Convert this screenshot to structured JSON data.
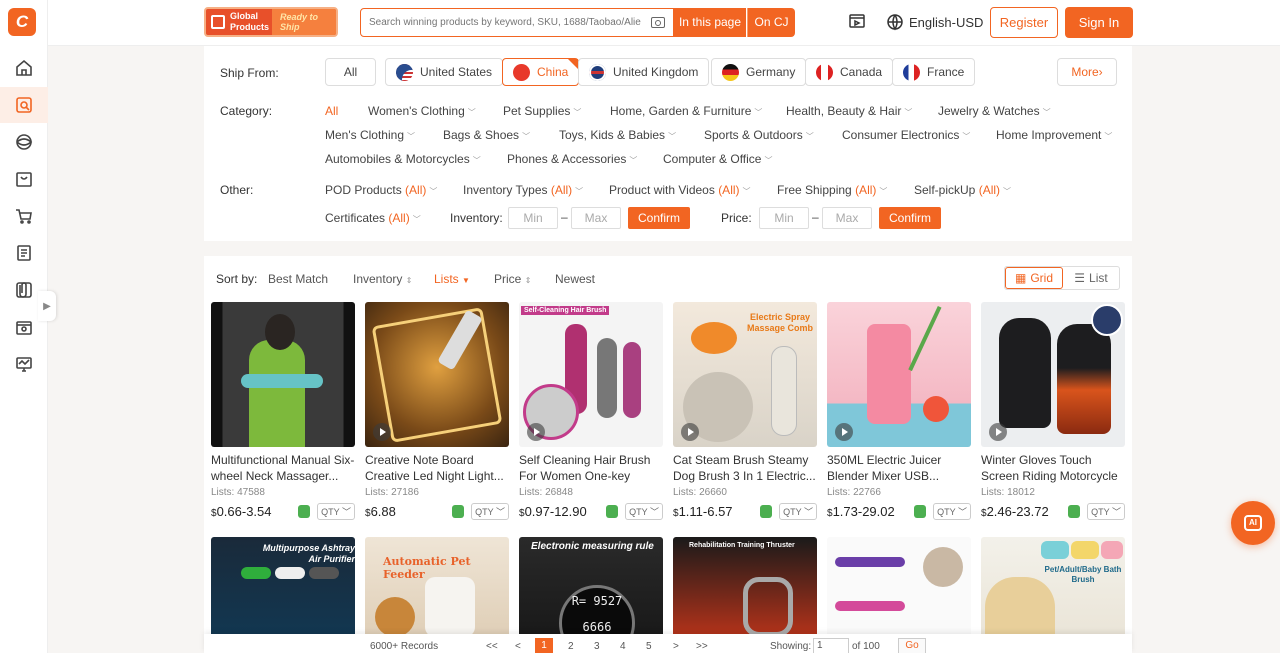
{
  "header": {
    "logo_text": "C",
    "banner_left": "Global Products",
    "banner_right": "Ready to Ship",
    "search_placeholder": "Search winning products by keyword, SKU, 1688/Taobao/Alie...",
    "search_in_page": "In this page",
    "search_on_cj": "On CJ",
    "language": "English-USD",
    "register": "Register",
    "sign_in": "Sign In"
  },
  "sidebar": {
    "items": [
      "home-icon",
      "product-search-icon",
      "globe-icon",
      "inbox-icon",
      "cart-icon",
      "orders-icon",
      "clip-icon",
      "store-icon",
      "monitor-icon"
    ],
    "active_index": 1
  },
  "filters": {
    "ship_from_label": "Ship From:",
    "countries": [
      {
        "label": "All",
        "flag": ""
      },
      {
        "label": "United States",
        "flag": "us"
      },
      {
        "label": "China",
        "flag": "cn",
        "selected": true
      },
      {
        "label": "United Kingdom",
        "flag": "uk"
      },
      {
        "label": "Germany",
        "flag": "de"
      },
      {
        "label": "Canada",
        "flag": "ca"
      },
      {
        "label": "France",
        "flag": "fr"
      }
    ],
    "more": "More",
    "category_label": "Category:",
    "categories": [
      "All",
      "Women's Clothing",
      "Pet Supplies",
      "Home, Garden & Furniture",
      "Health, Beauty & Hair",
      "Jewelry & Watches",
      "Men's Clothing",
      "Bags & Shoes",
      "Toys, Kids & Babies",
      "Sports & Outdoors",
      "Consumer Electronics",
      "Home Improvement",
      "Automobiles & Motorcycles",
      "Phones & Accessories",
      "Computer & Office"
    ],
    "other_label": "Other:",
    "other_items": [
      "POD Products",
      "Inventory Types",
      "Product with Videos",
      "Free Shipping",
      "Self-pickUp",
      "Certificates"
    ],
    "all_tag": "(All)",
    "inventory_label": "Inventory:",
    "price_label": "Price:",
    "min": "Min",
    "max": "Max",
    "confirm": "Confirm"
  },
  "sort": {
    "label": "Sort by:",
    "options": [
      "Best Match",
      "Inventory",
      "Lists",
      "Price",
      "Newest"
    ],
    "active": "Lists",
    "grid": "Grid",
    "list": "List"
  },
  "products": [
    {
      "title": "Multifunctional Manual Six-wheel Neck Massager...",
      "lists": "Lists: 47588",
      "currency": "$",
      "price": "0.66-3.54",
      "video": false
    },
    {
      "title": "Creative Note Board Creative Led Night Light...",
      "lists": "Lists: 27186",
      "currency": "$",
      "price": "6.88",
      "video": true
    },
    {
      "title": "Self Cleaning Hair Brush For Women One-key Cleaning...",
      "lists": "Lists: 26848",
      "currency": "$",
      "price": "0.97-12.90",
      "video": true
    },
    {
      "title": "Cat Steam Brush Steamy Dog Brush 3 In 1 Electric...",
      "lists": "Lists: 26660",
      "currency": "$",
      "price": "1.11-6.57",
      "video": true
    },
    {
      "title": "350ML Electric Juicer Blender Mixer USB...",
      "lists": "Lists: 22766",
      "currency": "$",
      "price": "1.73-29.02",
      "video": true
    },
    {
      "title": "Winter Gloves Touch Screen Riding Motorcycle Sliding...",
      "lists": "Lists: 18012",
      "currency": "$",
      "price": "2.46-23.72",
      "video": true
    }
  ],
  "image_texts": {
    "p3": "Self-Cleaning Hair Brush",
    "p4": "Electric Spray Massage Comb",
    "r1": "Multipurpose Ashtray Air Purifier",
    "r2": "Automatic Pet Feeder",
    "r3": "Electronic measuring rule",
    "r4": "Rehabilitation Training Thruster",
    "r6": "Pet/Adult/Baby Bath Brush"
  },
  "qty_label": "QTY",
  "pagination": {
    "records": "6000+ Records",
    "first": "<<",
    "prev": "<",
    "pages": [
      "1",
      "2",
      "3",
      "4",
      "5"
    ],
    "next": ">",
    "last": ">>",
    "showing_label": "Showing:",
    "showing_value": "1",
    "of_total": "of 100",
    "go": "Go"
  },
  "colors": {
    "accent": "#f26522"
  }
}
